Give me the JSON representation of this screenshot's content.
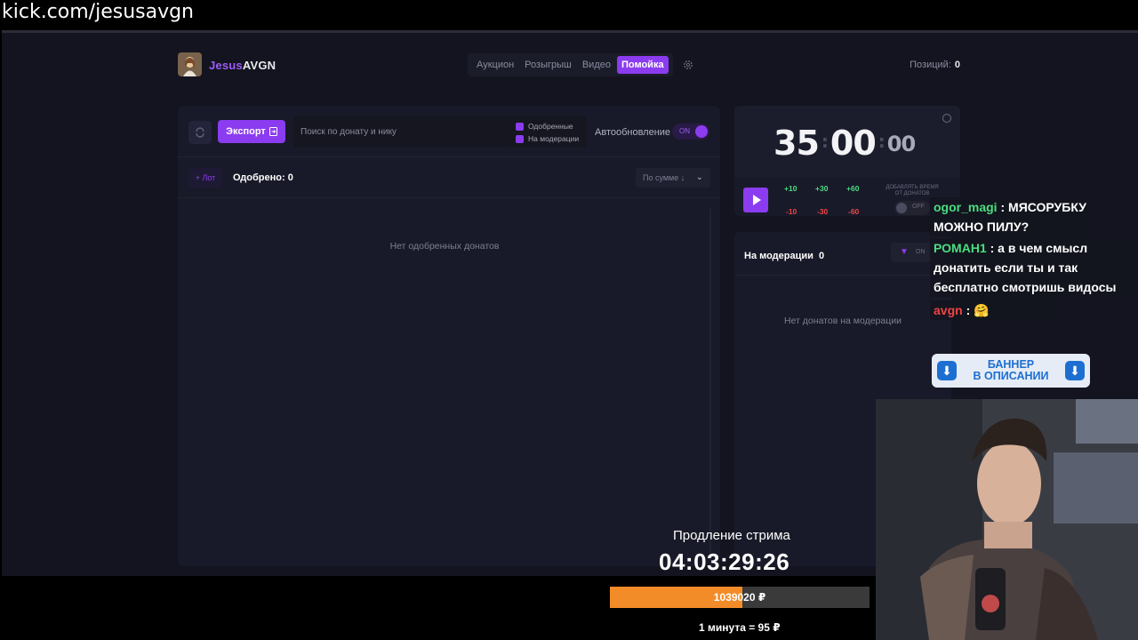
{
  "browser": {
    "url": "kick.com/jesusavgn"
  },
  "header": {
    "brand_part1": "Jesus",
    "brand_part2": "AVGN",
    "nav": [
      "Аукцион",
      "Розыгрыш",
      "Видео",
      "Помойка"
    ],
    "active_nav": "Помойка",
    "positions_label": "Позиций:",
    "positions_value": "0"
  },
  "toolbar": {
    "export_label": "Экспорт",
    "search_placeholder": "Поиск по донату и нику",
    "filter_approved": "Одобренные",
    "filter_moderation": "На модерации",
    "auto_refresh_label": "Автообновление",
    "auto_refresh_state": "ON"
  },
  "approved_section": {
    "lot_button": "+ Лот",
    "approved_label": "Одобрено: 0",
    "sort_label": "По сумме ↓",
    "empty_text": "Нет одобренных донатов"
  },
  "timer": {
    "minutes": "35",
    "seconds": "00",
    "centis": "00",
    "plus_buttons": [
      "+10",
      "+30",
      "+60"
    ],
    "minus_buttons": [
      "-10",
      "-30",
      "-60"
    ],
    "add_time_label": "ДОБАВЛЯТЬ ВРЕМЯ ОТ ДОНАТОВ",
    "add_time_state": "OFF"
  },
  "moderation": {
    "title": "На модерации",
    "count": "0",
    "filter_state": "ON",
    "empty_text": "Нет донатов на модерации"
  },
  "chat": {
    "messages": [
      {
        "user": "ogor_magi",
        "text": "МЯСОРУБКУ МОЖНО ПИЛУ?"
      },
      {
        "user": "РОМАН1",
        "text": "а в чем смысл донатить если ты и так бесплатно смотришь видосы"
      },
      {
        "user": "avgn",
        "text": "🤗"
      }
    ]
  },
  "banner": {
    "line1": "БАННЕР",
    "line2": "В ОПИСАНИИ"
  },
  "stream": {
    "label": "Продление стрима",
    "timer": "04:03:29:26",
    "amount": "1039020 ₽",
    "progress": 0.51,
    "rate": "1 минута = 95 ₽"
  },
  "colors": {
    "accent": "#8b3cf0",
    "plus": "#4ade80",
    "minus": "#ef4444",
    "progress": "#f28c28"
  }
}
